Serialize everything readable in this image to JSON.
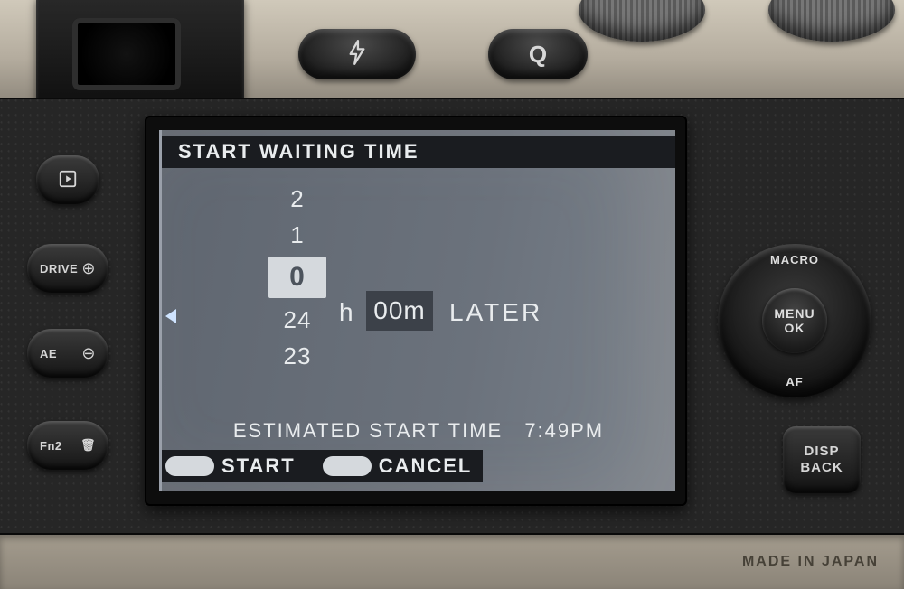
{
  "screen": {
    "title": "START WAITING TIME",
    "hour_options": [
      "2",
      "1",
      "0",
      "24",
      "23"
    ],
    "hour_selected": "0",
    "hour_unit": "h",
    "minutes": "00m",
    "suffix": "LATER",
    "estimated_label": "ESTIMATED START TIME",
    "estimated_value": "7:49PM",
    "action_start": "START",
    "action_cancel": "CANCEL"
  },
  "buttons": {
    "q": "Q",
    "drive": "DRIVE",
    "drive_mag": "⊕",
    "ae": "AE",
    "ae_mag": "⊖",
    "fn2": "Fn2",
    "trash_glyph": "🗑",
    "dpad_top": "MACRO",
    "dpad_bottom": "AF",
    "dpad_center1": "MENU",
    "dpad_center2": "OK",
    "disp1": "DISP",
    "disp2": "BACK"
  },
  "footer": "MADE IN JAPAN"
}
